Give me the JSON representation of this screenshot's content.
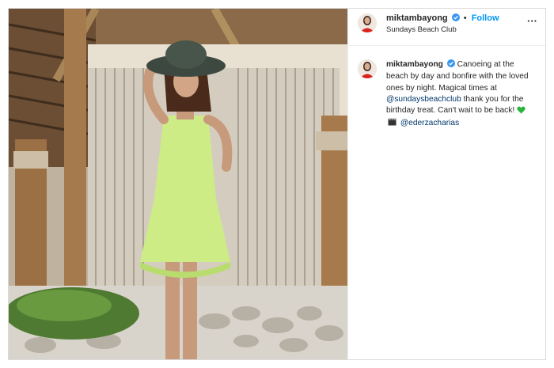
{
  "post": {
    "username": "miktambayong",
    "dot": "•",
    "follow_label": "Follow",
    "location": "Sundays Beach Club",
    "more_icon": "more-options-icon"
  },
  "photo": {
    "description_icon": "post-photo"
  },
  "caption": {
    "username": "miktambayong",
    "text_1": "Canoeing at the beach by day and bonfire with the loved ones by night. Magical times at",
    "mention_1": "@sundaysbeachclub",
    "text_2": "thank you for the birthday treat. Can't wait to be back!",
    "mention_2": "@ederzacharias",
    "emojis": [
      "green-heart-icon",
      "clapper-board-icon"
    ]
  },
  "colors": {
    "link_blue": "#0095f6",
    "mention": "#00376b",
    "text": "#262626",
    "border": "#dbdbdb"
  }
}
